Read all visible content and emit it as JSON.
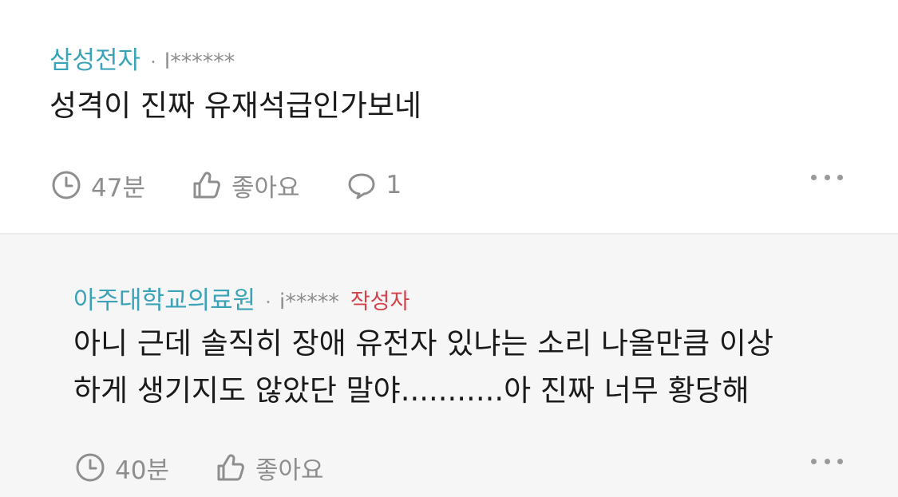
{
  "comments": [
    {
      "author": "삼성전자",
      "separator": "·",
      "user_id": "l******",
      "body": [
        "성격이 진짜 유재석급인가보네"
      ],
      "time": "47분",
      "like_label": "좋아요",
      "reply_count": "1"
    }
  ],
  "reply": {
    "author": "아주대학교의료원",
    "separator": "·",
    "user_id": "i*****",
    "writer_badge": "작성자",
    "body": [
      "아니 근데 솔직히 장애 유전자 있냐는 소리 나올만큼 이상",
      "하게 생기지도 않았단 말야...........아 진짜 너무 황당해"
    ],
    "time": "40분",
    "like_label": "좋아요"
  },
  "icons": {
    "clock": "clock-icon",
    "like": "thumbs-up-icon",
    "reply": "speech-bubble-icon",
    "more": "more-options-icon"
  },
  "colors": {
    "author": "#3aa3b8",
    "writer_badge": "#d2434b",
    "meta": "#8e8e8e",
    "reply_background": "#f6f6f6"
  }
}
